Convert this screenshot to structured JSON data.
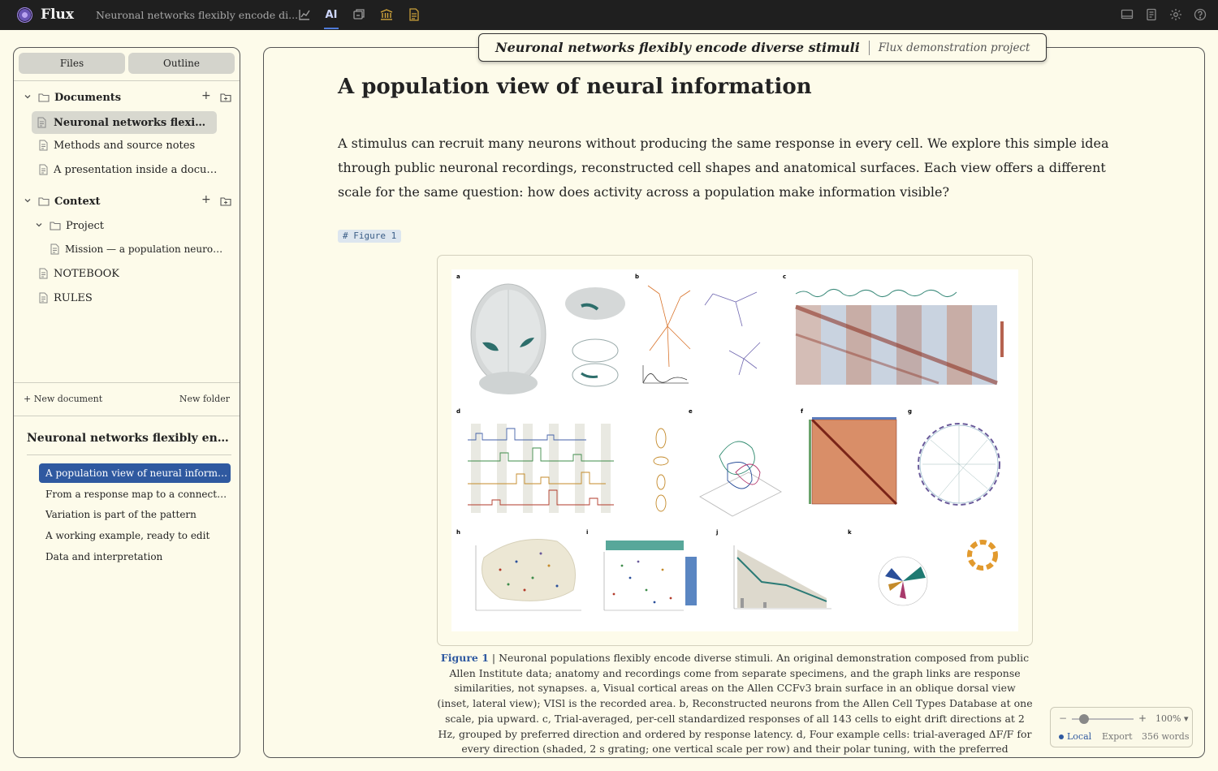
{
  "topbar": {
    "brand": "Flux",
    "document_title": "Neuronal networks flexibly encode di...",
    "tools": [
      "chart-icon",
      "AI",
      "layers-icon",
      "library-icon",
      "document-icon"
    ],
    "ai_label": "AI",
    "right_tools": [
      "display-icon",
      "book-icon",
      "gear-icon",
      "help-icon"
    ]
  },
  "sidebar": {
    "tabs": [
      "Files",
      "Outline"
    ],
    "documents_label": "Documents",
    "documents": [
      "Neuronal networks flexibly ...",
      "Methods and source notes",
      "A presentation inside a document"
    ],
    "context_label": "Context",
    "project_label": "Project",
    "project_items": [
      "Mission — a population neuroscie..."
    ],
    "context_items": [
      "NOTEBOOK",
      "RULES"
    ],
    "new_document": "+ New document",
    "new_folder": "New folder",
    "outline_title": "Neuronal networks flexibly enc...",
    "outline": [
      "A population view of neural informati...",
      "From a response map to a connected ...",
      "Variation is part of the pattern",
      "A working example, ready to edit",
      "Data and interpretation"
    ]
  },
  "main": {
    "chip_title": "Neuronal networks flexibly encode diverse stimuli",
    "chip_project": "Flux demonstration project",
    "heading": "A population view of neural information",
    "paragraph": "A stimulus can recruit many neurons without producing the same response in every cell. We explore this simple idea through public neuronal recordings, reconstructed cell shapes and anatomical surfaces. Each view offers a different scale for the same question: how does activity across a population make information visible?",
    "figure_tag": "# Figure 1",
    "figure_panel_letters": [
      "a",
      "b",
      "c",
      "d",
      "e",
      "f",
      "g",
      "h",
      "i",
      "j",
      "k"
    ],
    "caption_label": "Figure 1",
    "caption_text": "| Neuronal populations flexibly encode diverse stimuli. An original demonstration composed from public Allen Institute data; anatomy and recordings come from separate specimens, and the graph links are response similarities, not synapses. a, Visual cortical areas on the Allen CCFv3 brain surface in an oblique dorsal view (inset, lateral view); VISl is the recorded area. b, Reconstructed neurons from the Allen Cell Types Database at one scale, pia upward. c, Trial-averaged, per-cell standardized responses of all 143 cells to eight drift directions at 2 Hz, grouped by preferred direction and ordered by response latency. d, Four example cells: trial-averaged ΔF/F for every direction (shaded, 2 s grating; one vertical scale per row) and their polar tuning, with the preferred direction marked. e, Population trajectories in one three-dimensional PCA basis; saturated segments are stimulus"
  },
  "zoom": {
    "minus": "−",
    "plus": "+",
    "level": "100%",
    "level_fraction": 0.2,
    "local": "Local",
    "export": "Export",
    "word_count": "356 words"
  },
  "colors": {
    "topbar": "#1f1f1f",
    "page_bg": "#fdfbea",
    "accent": "#2f59a0",
    "selection": "#d8d8cf"
  }
}
